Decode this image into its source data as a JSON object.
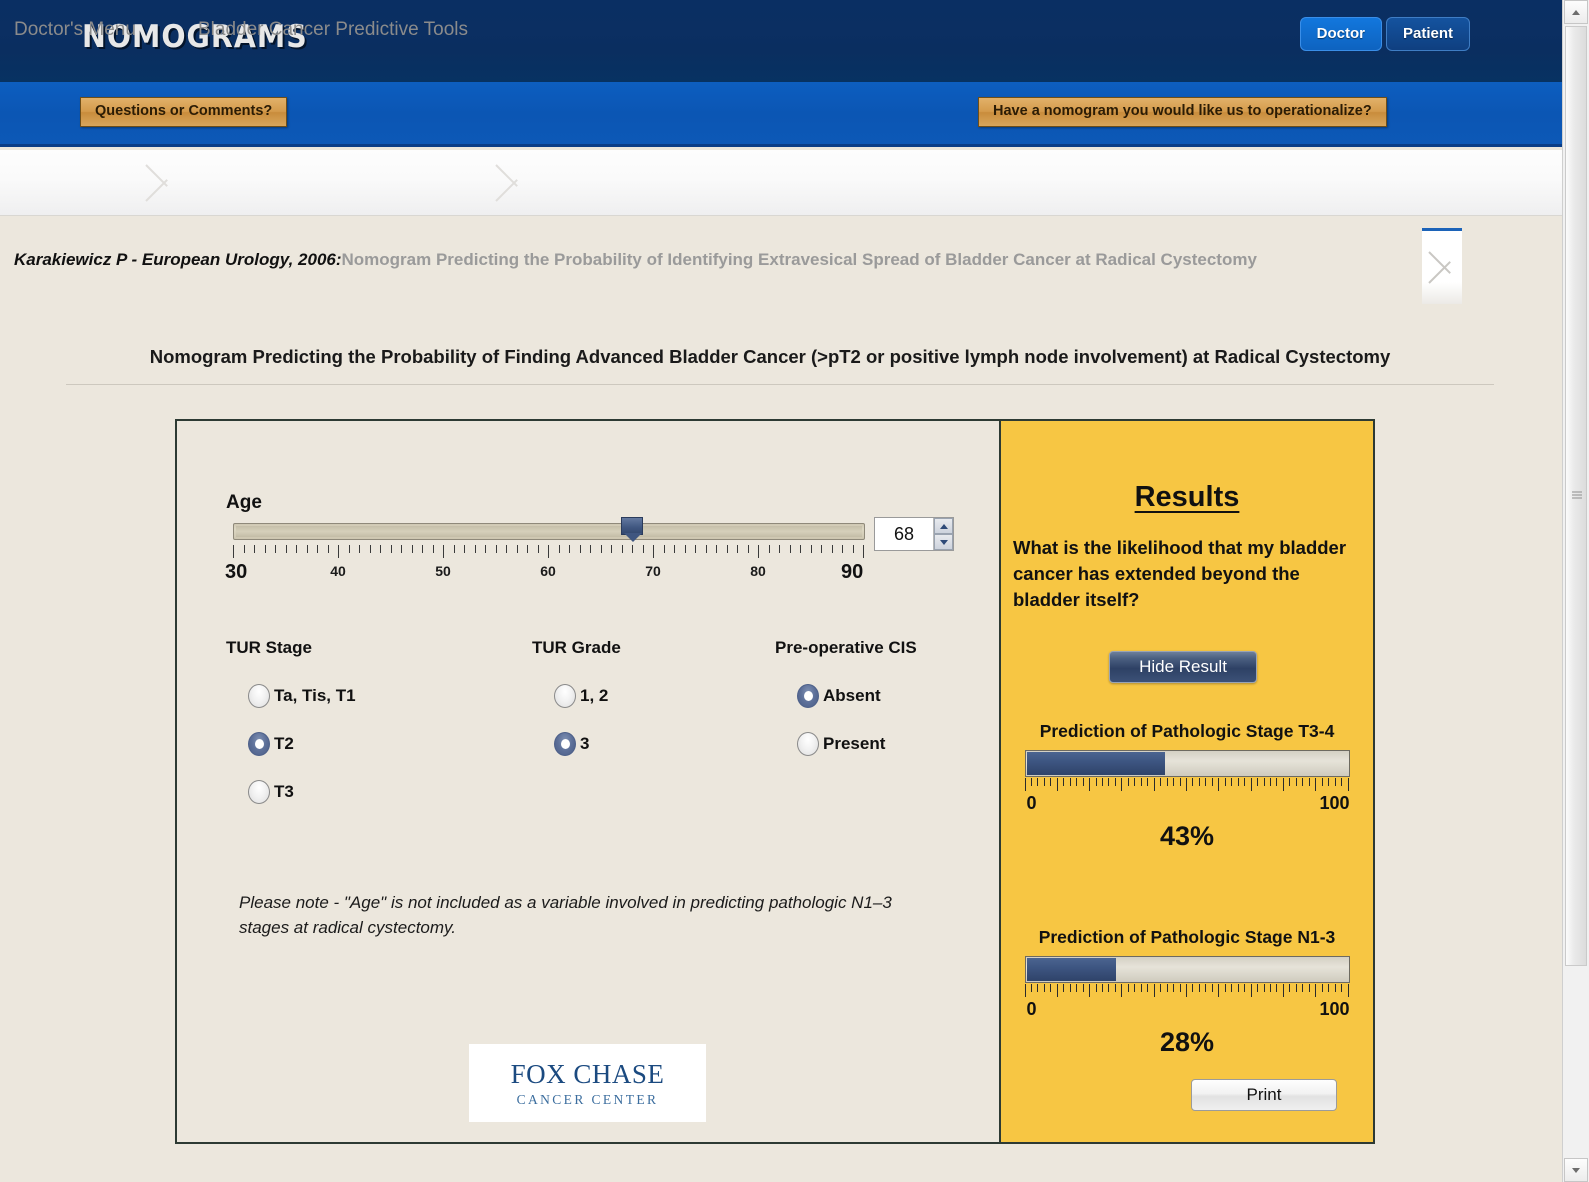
{
  "header": {
    "logo_text": "NOMOGRAMS",
    "nav": [
      {
        "label": "Doctor",
        "state": "active"
      },
      {
        "label": "Patient",
        "state": "inactive"
      }
    ],
    "questions_button": "Questions or Comments?",
    "operationalize_button": "Have a nomogram you would like us to operationalize?"
  },
  "breadcrumb": {
    "items": [
      {
        "label": "Doctor's Menu"
      },
      {
        "label": "Bladder Cancer Predictive Tools"
      }
    ]
  },
  "citation": {
    "author": "Karakiewicz P - European Urology, 2006:",
    "title": "Nomogram Predicting the Probability of Identifying Extravesical Spread of Bladder Cancer at Radical Cystectomy"
  },
  "nomogram": {
    "title": "Nomogram Predicting the Probability of Finding Advanced Bladder Cancer (>pT2 or positive lymph node involvement) at Radical Cystectomy"
  },
  "form": {
    "age": {
      "label": "Age",
      "value": "68",
      "min": 30,
      "max": 90,
      "min_label": "30",
      "max_label": "90",
      "ticks": [
        "40",
        "50",
        "60",
        "70",
        "80"
      ]
    },
    "tur_stage": {
      "title": "TUR Stage",
      "options": [
        {
          "label": "Ta, Tis, T1",
          "checked": false
        },
        {
          "label": "T2",
          "checked": true
        },
        {
          "label": "T3",
          "checked": false
        }
      ]
    },
    "tur_grade": {
      "title": "TUR Grade",
      "options": [
        {
          "label": "1, 2",
          "checked": false
        },
        {
          "label": "3",
          "checked": true
        }
      ]
    },
    "preop_cis": {
      "title": "Pre-operative CIS",
      "options": [
        {
          "label": "Absent",
          "checked": true
        },
        {
          "label": "Present",
          "checked": false
        }
      ]
    },
    "note": "Please note - \"Age\" is not included as a variable involved in predicting pathologic N1–3 stages at radical cystectomy."
  },
  "logo": {
    "line1": "FOX CHASE",
    "line2": "CANCER CENTER"
  },
  "results": {
    "title": "Results",
    "question": "What is the likelihood that my bladder cancer has extended beyond the bladder itself?",
    "hide_button": "Hide Result",
    "print_button": "Print",
    "predictions": [
      {
        "title": "Prediction of Pathologic Stage T3-4",
        "percent": "43%",
        "value": 43,
        "scale_min": "0",
        "scale_max": "100"
      },
      {
        "title": "Prediction of Pathologic Stage N1-3",
        "percent": "28%",
        "value": 28,
        "scale_min": "0",
        "scale_max": "100"
      }
    ]
  },
  "colors": {
    "navy": "#0a2f63",
    "blue": "#0d58b6",
    "gold_button": "#d49b4c",
    "results_panel": "#f7c643",
    "page_bg": "#ece7dd",
    "bar_fill": "#3c5480"
  }
}
